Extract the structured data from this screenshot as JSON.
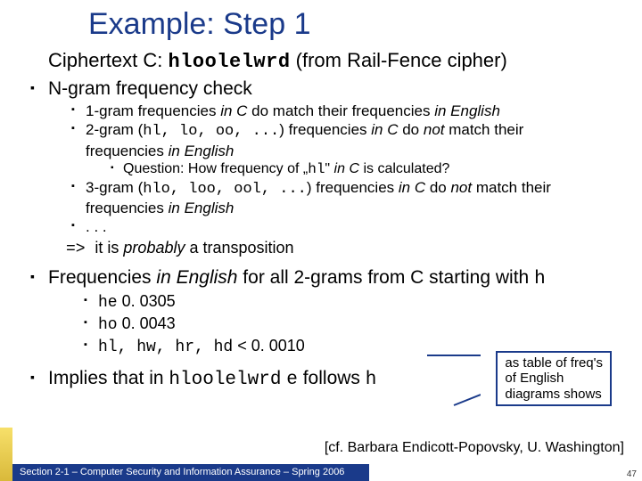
{
  "title": "Example: Step 1",
  "ciphertext_line": {
    "label": "Ciphertext C:  ",
    "value": "hloolelwrd",
    "note": " (from Rail-Fence cipher)"
  },
  "ngram": {
    "heading": "N-gram frequency check",
    "p1a": "1-gram frequencies ",
    "p1b": "in C",
    "p1c": " do match their frequencies ",
    "p1d": "in English",
    "p2a": "2-gram (",
    "p2code": "hl, lo, oo, ...",
    "p2b": ") frequencies ",
    "p2c": "in C",
    "p2d": " do ",
    "p2e": "not ",
    "p2f": " match their",
    "p2g": "frequencies ",
    "p2h": "in English",
    "q1": "Question: How frequency of „",
    "q2": "hl",
    "q3": "\" ",
    "q4": "in C",
    "q5": " is calculated?",
    "p3a": "3-gram (",
    "p3code": "hlo, loo, ool, ...",
    "p3b": ") frequencies ",
    "p3c": "in C",
    "p3d": " do ",
    "p3e": "not ",
    "p3f": " match their",
    "p3g": "frequencies ",
    "p3h": "in English",
    "dots": ". . .",
    "arrow_a": "=> ",
    "arrow_b": "it is ",
    "arrow_c": "probably",
    "arrow_d": " a transposition"
  },
  "freq": {
    "heading_a": "Frequencies ",
    "heading_b": "in English",
    "heading_c": " for all 2-grams from C starting with ",
    "heading_d": "h",
    "rows": [
      {
        "code": "he",
        "val": "  0. 0305"
      },
      {
        "code": "ho",
        "val": "  0. 0043"
      },
      {
        "code": "hl, hw, hr, hd",
        "val": " < 0. 0010"
      }
    ],
    "callout": {
      "l1": "as table of freq's",
      "l2": "of English",
      "l3": "diagrams shows"
    }
  },
  "implies": {
    "a": "Implies that in ",
    "b": "hloolelwrd",
    "c": " ",
    "d": "e",
    "e": " follows ",
    "f": "h"
  },
  "citation": "[cf. Barbara Endicott-Popovsky, U. Washington]",
  "footer": "Section 2-1 – Computer Security and Information Assurance – Spring 2006",
  "pagenum": "47"
}
